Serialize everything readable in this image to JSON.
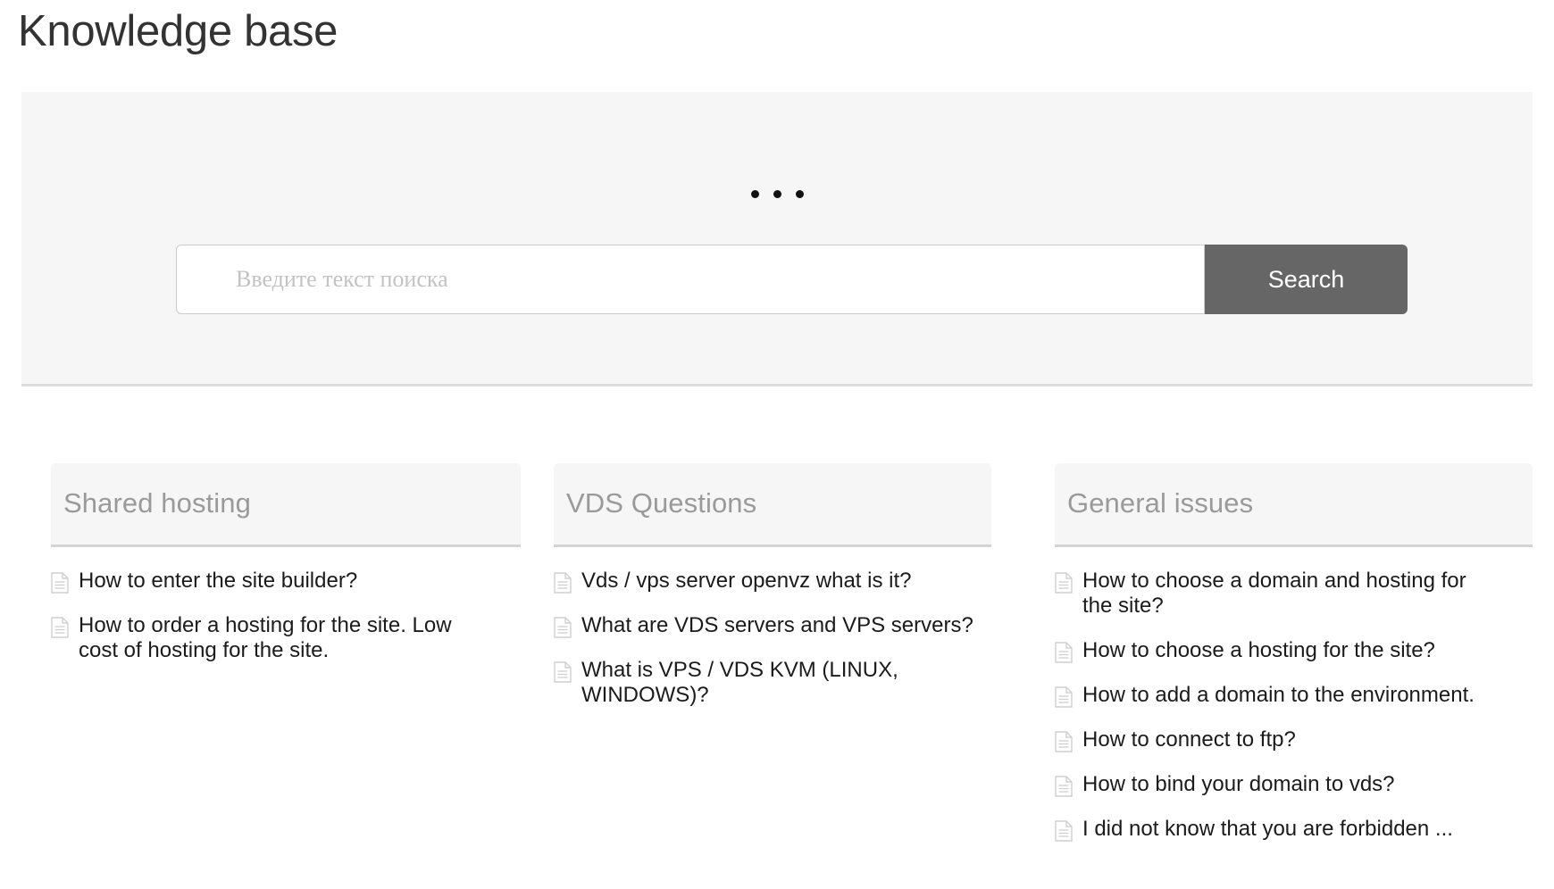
{
  "page": {
    "title": "Knowledge base"
  },
  "hero": {
    "dots_icon": "three-dots-loading-icon",
    "dots_count": 3,
    "search": {
      "placeholder": "Введите текст поиска",
      "value": "",
      "button_label": "Search",
      "button_color": "#666666"
    },
    "background_color": "#f6f6f6"
  },
  "columns": [
    {
      "id": "shared-hosting",
      "title": "Shared hosting",
      "articles": [
        {
          "icon": "document-icon",
          "label": "How to enter the site builder?"
        },
        {
          "icon": "document-icon",
          "label": "How to order a hosting for the site. Low cost of hosting for the site."
        }
      ]
    },
    {
      "id": "vds-questions",
      "title": "VDS Questions",
      "articles": [
        {
          "icon": "document-icon",
          "label": "Vds / vps server openvz what is it?"
        },
        {
          "icon": "document-icon",
          "label": "What are VDS servers and VPS servers?"
        },
        {
          "icon": "document-icon",
          "label": "What is VPS / VDS KVM (LINUX, WINDOWS)?"
        }
      ]
    },
    {
      "id": "general-issues",
      "title": "General issues",
      "articles": [
        {
          "icon": "document-icon",
          "label": "How to choose a domain and hosting for the site?"
        },
        {
          "icon": "document-icon",
          "label": "How to choose a hosting for the site?"
        },
        {
          "icon": "document-icon",
          "label": "How to add a domain to the environment."
        },
        {
          "icon": "document-icon",
          "label": "How to connect to ftp?"
        },
        {
          "icon": "document-icon",
          "label": "How to bind your domain to vds?"
        },
        {
          "icon": "document-icon",
          "label": "I did not know that you are forbidden ..."
        }
      ]
    }
  ],
  "colors": {
    "title_text": "#333333",
    "card_header_text": "#9a9a9a",
    "article_text": "#1b1b1b",
    "placeholder_text": "#c3c3c3",
    "panel_bg": "#f6f6f6",
    "divider": "#d4d4d4"
  }
}
